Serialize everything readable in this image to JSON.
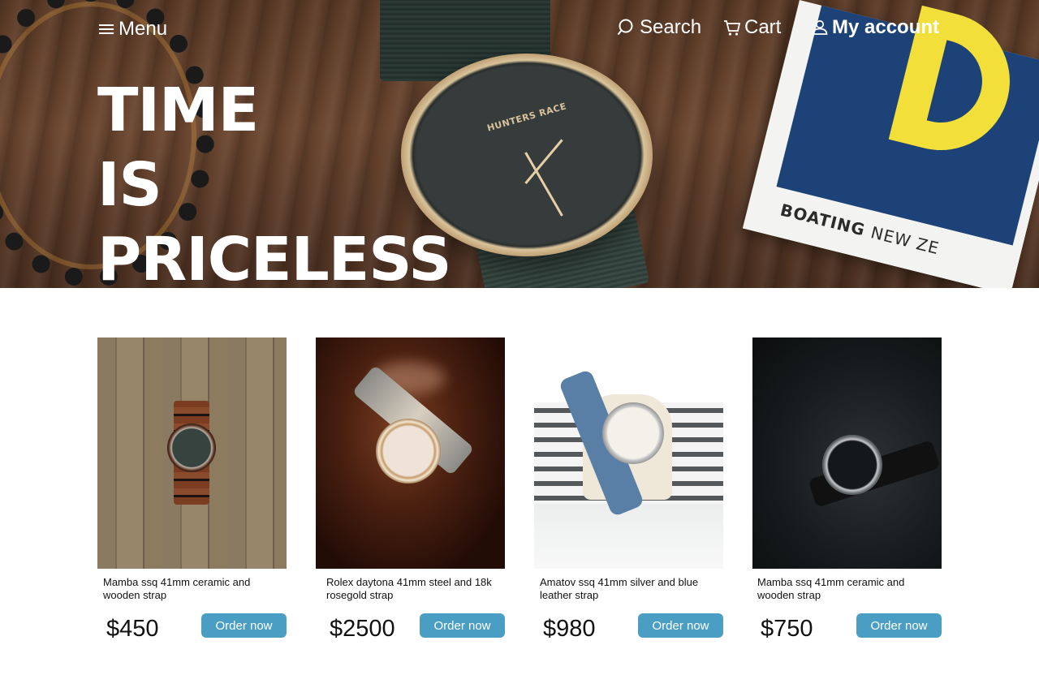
{
  "nav": {
    "menu": "Menu",
    "search": "Search",
    "cart": "Cart",
    "account": "My account"
  },
  "hero": {
    "headline": [
      "TIME",
      "IS",
      "PRICELESS"
    ],
    "watch_brand": "HUNTERS RACE",
    "magazine_text": "BOATING",
    "magazine_text2": "NEW ZE"
  },
  "products": [
    {
      "title": "Mamba ssq 41mm ceramic and wooden strap",
      "price": "$450",
      "button": "Order now"
    },
    {
      "title": "Rolex daytona 41mm steel and 18k rosegold strap",
      "price": "$2500",
      "button": "Order now"
    },
    {
      "title": "Amatov ssq 41mm silver and blue leather strap",
      "price": "$980",
      "button": "Order now"
    },
    {
      "title": "Mamba ssq 41mm ceramic and wooden strap",
      "price": "$750",
      "button": "Order now"
    }
  ],
  "colors": {
    "button": "#4a9ec4",
    "nav_text": "#ffffff"
  },
  "icons": [
    "hamburger-menu-icon",
    "search-icon",
    "cart-icon",
    "user-icon"
  ]
}
